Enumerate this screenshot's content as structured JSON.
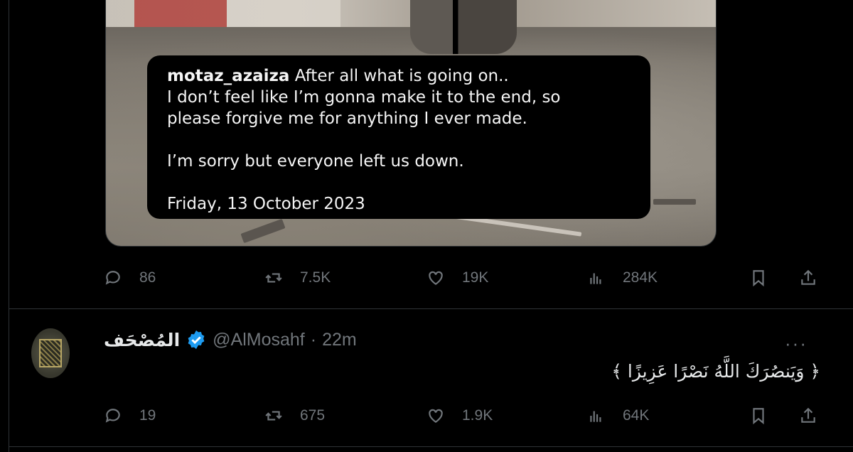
{
  "post1": {
    "caption": {
      "username": "motaz_azaiza",
      "line1": "After all what is going on..",
      "line2": "I don’t feel like I’m gonna make it to the end, so",
      "line3": "please forgive me for anything I ever made.",
      "line4": "I’m sorry but everyone left us down.",
      "date": "Friday, 13 October 2023"
    },
    "actions": {
      "replies": "86",
      "reposts": "7.5K",
      "likes": "19K",
      "views": "284K"
    }
  },
  "post2": {
    "display_name": "المُصْحَف",
    "handle": "@AlMosahf",
    "separator": "·",
    "time": "22m",
    "more": "···",
    "text": "﴿ وَيَنصُرَكَ اللَّهُ نَصْرًا عَزِيزًا ﴾",
    "actions": {
      "replies": "19",
      "reposts": "675",
      "likes": "1.9K",
      "views": "64K"
    }
  },
  "colors": {
    "background": "#000000",
    "text": "#e7e9ea",
    "muted": "#71767b",
    "verified": "#1d9bf0",
    "border": "#2f3336"
  },
  "icons": [
    "reply-icon",
    "repost-icon",
    "like-icon",
    "views-icon",
    "bookmark-icon",
    "share-icon",
    "verified-badge-icon",
    "more-icon"
  ]
}
